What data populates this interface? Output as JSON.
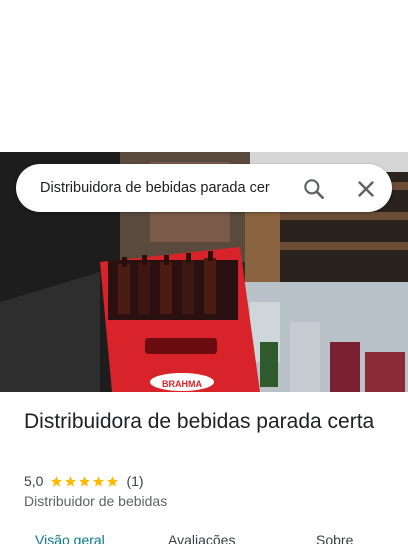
{
  "search": {
    "query": "Distribuidora de bebidas parada cer"
  },
  "place": {
    "title": "Distribuidora de bebidas parada certa",
    "rating": "5,0",
    "stars": 5,
    "review_count": "(1)",
    "category": "Distribuidor de bebidas",
    "photo_crate_brand": "BRAHMA"
  },
  "tabs": [
    {
      "label": "Visão geral",
      "active": true
    },
    {
      "label": "Avaliações",
      "active": false
    },
    {
      "label": "Sobre",
      "active": false
    }
  ],
  "colors": {
    "accent_tab": "#0b7a8a",
    "star": "#fbbc04",
    "crate": "#d8232a"
  },
  "icons": {
    "search": "search-icon",
    "close": "close-icon",
    "star": "star-icon"
  }
}
